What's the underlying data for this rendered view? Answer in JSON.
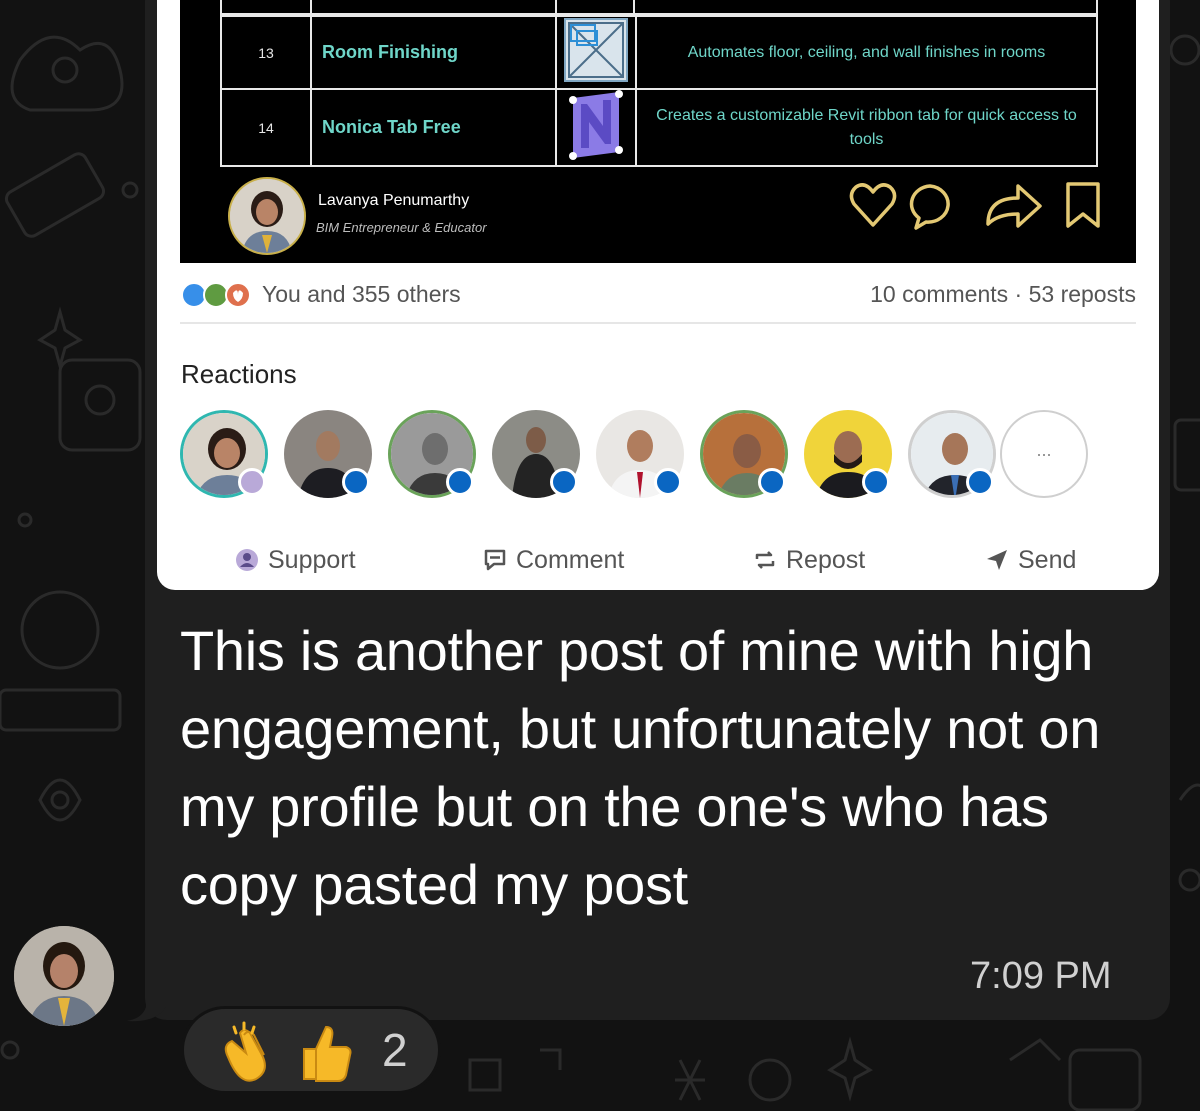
{
  "post_table": {
    "rows": [
      {
        "number": "13",
        "name": "Room Finishing",
        "description": "Automates floor, ceiling, and wall finishes in rooms",
        "icon": "room-finishing-icon"
      },
      {
        "number": "14",
        "name": "Nonica Tab Free",
        "description": "Creates a customizable Revit ribbon tab for quick access to tools",
        "icon": "nonica-tab-icon"
      }
    ]
  },
  "post_author": {
    "name": "Lavanya Penumarthy",
    "title": "BIM Entrepreneur & Educator"
  },
  "engagement": {
    "likes_text": "You and 355 others",
    "stats_text": "10 comments · 53 reposts"
  },
  "reactions_section": {
    "label": "Reactions",
    "more_label": "..."
  },
  "action_bar": {
    "support": "Support",
    "comment": "Comment",
    "repost": "Repost",
    "send": "Send"
  },
  "message": {
    "text": "This is another post of mine with high engagement, but unfortunately not on my profile but on the one's who has copy pasted my post",
    "time": "7:09 PM"
  },
  "message_reactions": {
    "emojis": [
      "clapping-hands-icon",
      "thumbs-up-icon"
    ],
    "count": "2"
  },
  "colors": {
    "chat_background": "#121212",
    "bubble": "#1f1f1f",
    "accent_teal": "#6fd6c9",
    "linkedin_blue": "#0a66c2"
  }
}
